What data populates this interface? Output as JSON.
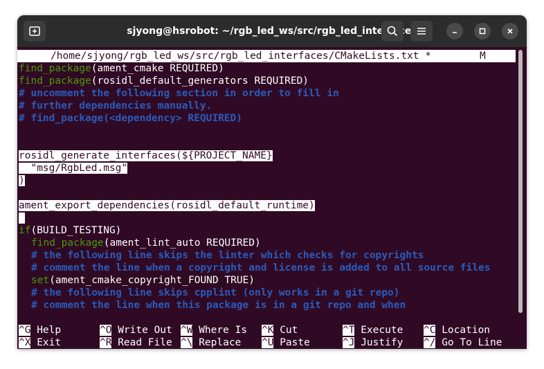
{
  "window": {
    "title": "sjyong@hsrobot: ~/rgb_led_ws/src/rgb_led_interfaces",
    "icons": {
      "new_tab": "new-tab-icon",
      "search": "search-icon",
      "menu": "hamburger-menu-icon",
      "minimize": "minimize-icon",
      "maximize": "maximize-icon",
      "close": "close-icon"
    }
  },
  "editor": {
    "file_path": "/home/sjyong/rgb_led_ws/src/rgb_led_interfaces/CMakeLists.txt *",
    "modified_flag": "M",
    "lines": {
      "l1_kw": "find_package",
      "l1_rest": "(ament_cmake REQUIRED)",
      "l2_kw": "find_package",
      "l2_rest": "(rosidl_default_generators REQUIRED)",
      "l3": "# uncomment the following section in order to fill in",
      "l4": "# further dependencies manually.",
      "l5": "# find_package(<dependency> REQUIRED)",
      "l8": "rosidl_generate_interfaces(${PROJECT_NAME}",
      "l9": "  \"msg/RgbLed.msg\"",
      "l10": ")",
      "l12": "ament_export_dependencies(rosidl_default_runtime)",
      "l14_kw": "if",
      "l14_rest": "(BUILD_TESTING)",
      "l15_kw": "find_package",
      "l15_rest": "(ament_lint_auto REQUIRED)",
      "l16": "# the following line skips the linter which checks for copyrights",
      "l17": "# comment the line when a copyright and license is added to all source files",
      "l18_kw": "set",
      "l18_rest": "(ament_cmake_copyright_FOUND TRUE)",
      "l19": "# the following line skips cpplint (only works in a git repo)",
      "l20": "# comment the line when this package is in a git repo and when"
    }
  },
  "shortcuts": [
    {
      "key": "^G",
      "label": "Help"
    },
    {
      "key": "^O",
      "label": "Write Out"
    },
    {
      "key": "^W",
      "label": "Where Is"
    },
    {
      "key": "^K",
      "label": "Cut"
    },
    {
      "key": "^T",
      "label": "Execute"
    },
    {
      "key": "^C",
      "label": "Location"
    },
    {
      "key": "^X",
      "label": "Exit"
    },
    {
      "key": "^R",
      "label": "Read File"
    },
    {
      "key": "^\\",
      "label": "Replace"
    },
    {
      "key": "^U",
      "label": "Paste"
    },
    {
      "key": "^J",
      "label": "Justify"
    },
    {
      "key": "^/",
      "label": "Go To Line"
    }
  ],
  "colors": {
    "terminal_bg": "#300a24",
    "titlebar_bg": "#2c2c2c",
    "keyword": "#4e9a06",
    "comment": "#2a5bbd"
  }
}
